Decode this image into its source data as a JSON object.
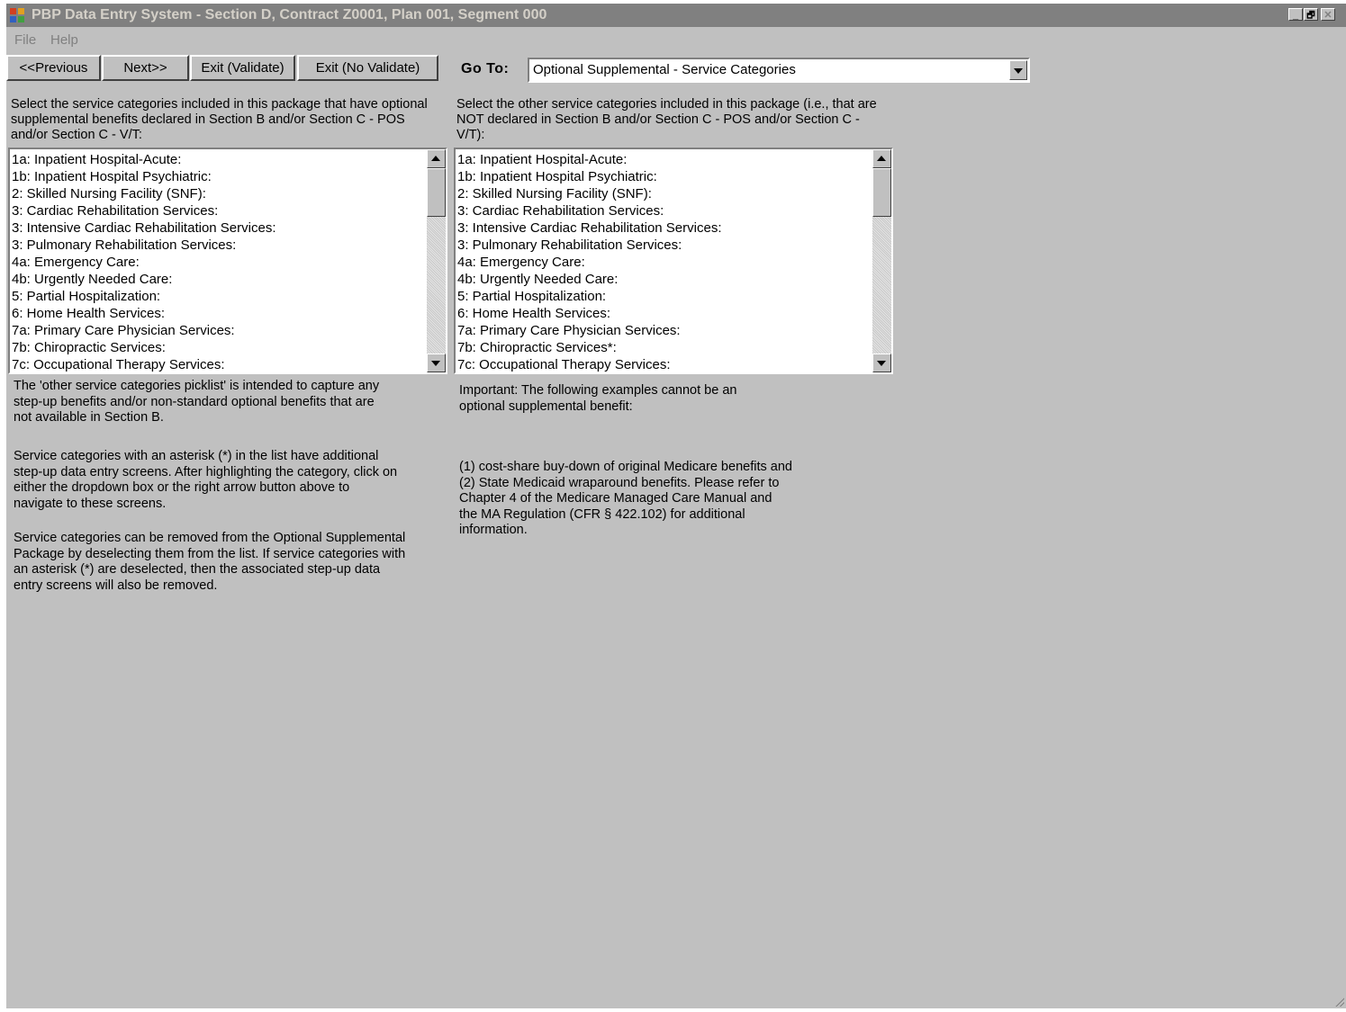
{
  "window": {
    "title": "PBP Data Entry System - Section D, Contract Z0001, Plan 001, Segment 000",
    "minimize_glyph": "_",
    "restore_glyph": "🗗",
    "close_glyph": "✕"
  },
  "menu": {
    "file": "File",
    "help": "Help"
  },
  "toolbar": {
    "previous": "<<Previous",
    "next": "Next>>",
    "exit_validate": "Exit (Validate)",
    "exit_no_validate": "Exit (No Validate)"
  },
  "goto": {
    "label": "Go To:",
    "selected": "Optional Supplemental - Service Categories"
  },
  "left_panel": {
    "instruction": "Select the service categories included in this package that have optional supplemental benefits declared in Section B and/or Section C - POS and/or Section C - V/T:",
    "items": [
      "1a: Inpatient Hospital-Acute:",
      "1b: Inpatient Hospital Psychiatric:",
      "2: Skilled Nursing Facility (SNF):",
      "3: Cardiac Rehabilitation Services:",
      "3: Intensive Cardiac Rehabilitation Services:",
      "3: Pulmonary Rehabilitation Services:",
      "4a: Emergency Care:",
      "4b: Urgently Needed Care:",
      "5: Partial Hospitalization:",
      "6: Home Health Services:",
      "7a: Primary Care Physician Services:",
      "7b: Chiropractic Services:",
      "7c: Occupational Therapy Services:"
    ],
    "note1": "The 'other service categories picklist' is intended to capture any step-up benefits and/or non-standard optional benefits that are not available in Section B.",
    "note2": "Service categories with an asterisk (*) in the list have additional step-up data entry screens.  After highlighting the category, click on either the dropdown box or the right arrow button above to navigate to these screens.",
    "note3": "Service categories can be removed from the Optional Supplemental Package by deselecting them from the list.  If service categories with an asterisk (*) are deselected, then the associated step-up data entry screens will also be removed."
  },
  "right_panel": {
    "instruction": "Select the other service categories included in this package (i.e., that are NOT declared in Section B and/or Section C - POS and/or Section C - V/T):",
    "items": [
      "1a: Inpatient Hospital-Acute:",
      "1b: Inpatient Hospital Psychiatric:",
      "2: Skilled Nursing Facility (SNF):",
      "3: Cardiac Rehabilitation Services:",
      "3: Intensive Cardiac Rehabilitation Services:",
      "3: Pulmonary Rehabilitation Services:",
      "4a: Emergency Care:",
      "4b: Urgently Needed Care:",
      "5: Partial Hospitalization:",
      "6: Home Health Services:",
      "7a: Primary Care Physician Services:",
      "7b: Chiropractic Services*:",
      "7c: Occupational Therapy Services:"
    ],
    "important": "Important: The following examples cannot be an optional supplemental benefit:",
    "examples": "(1) cost-share buy-down of original Medicare benefits and (2) State Medicaid wraparound benefits. Please refer to Chapter 4 of the Medicare Managed Care Manual and the MA Regulation (CFR § 422.102) for additional information."
  }
}
